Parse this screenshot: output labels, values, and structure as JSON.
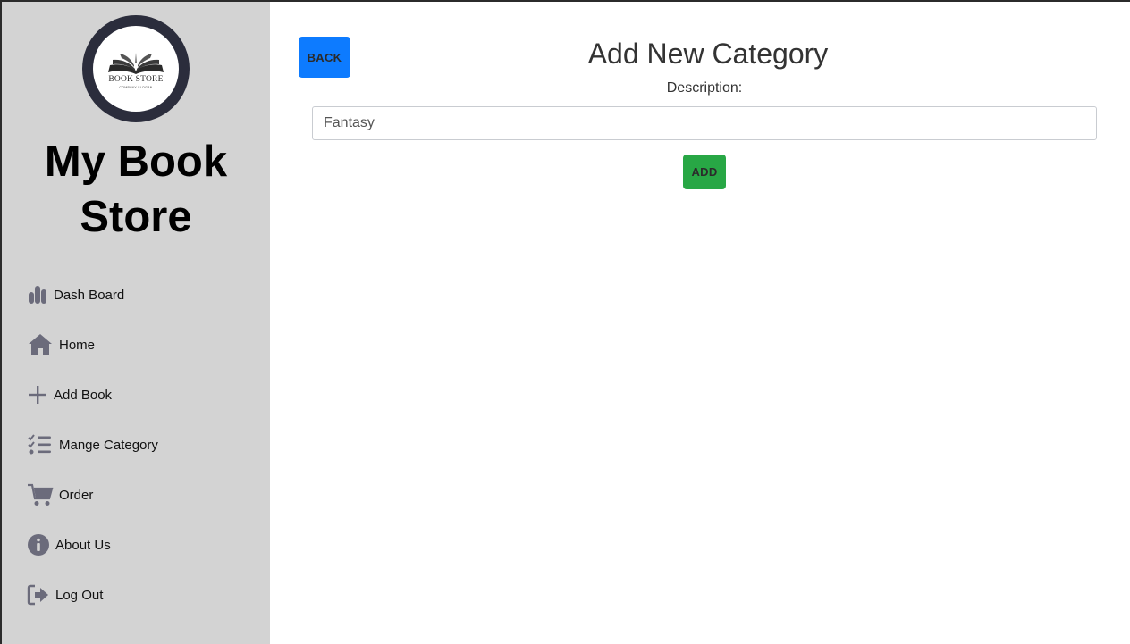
{
  "sidebar": {
    "logo": {
      "name": "BOOK STORE",
      "slogan": "COMPANY SLOGAN",
      "ring_color": "#2b2d3c"
    },
    "store_title": "My Book Store",
    "items": [
      {
        "label": "Dash Board",
        "icon": "bar-chart-icon"
      },
      {
        "label": "Home",
        "icon": "home-icon"
      },
      {
        "label": "Add Book",
        "icon": "plus-icon"
      },
      {
        "label": "Mange Category",
        "icon": "checklist-icon"
      },
      {
        "label": "Order",
        "icon": "cart-icon"
      },
      {
        "label": "About Us",
        "icon": "info-icon"
      },
      {
        "label": "Log Out",
        "icon": "logout-icon"
      }
    ],
    "background": "#d3d3d3",
    "icon_color": "#6b6b7b"
  },
  "main": {
    "back_label": "BACK",
    "title": "Add New Category",
    "description_label": "Description:",
    "description_value": "Fantasy",
    "add_label": "ADD"
  },
  "colors": {
    "back_button": "#0d7bff",
    "add_button": "#28a745"
  }
}
